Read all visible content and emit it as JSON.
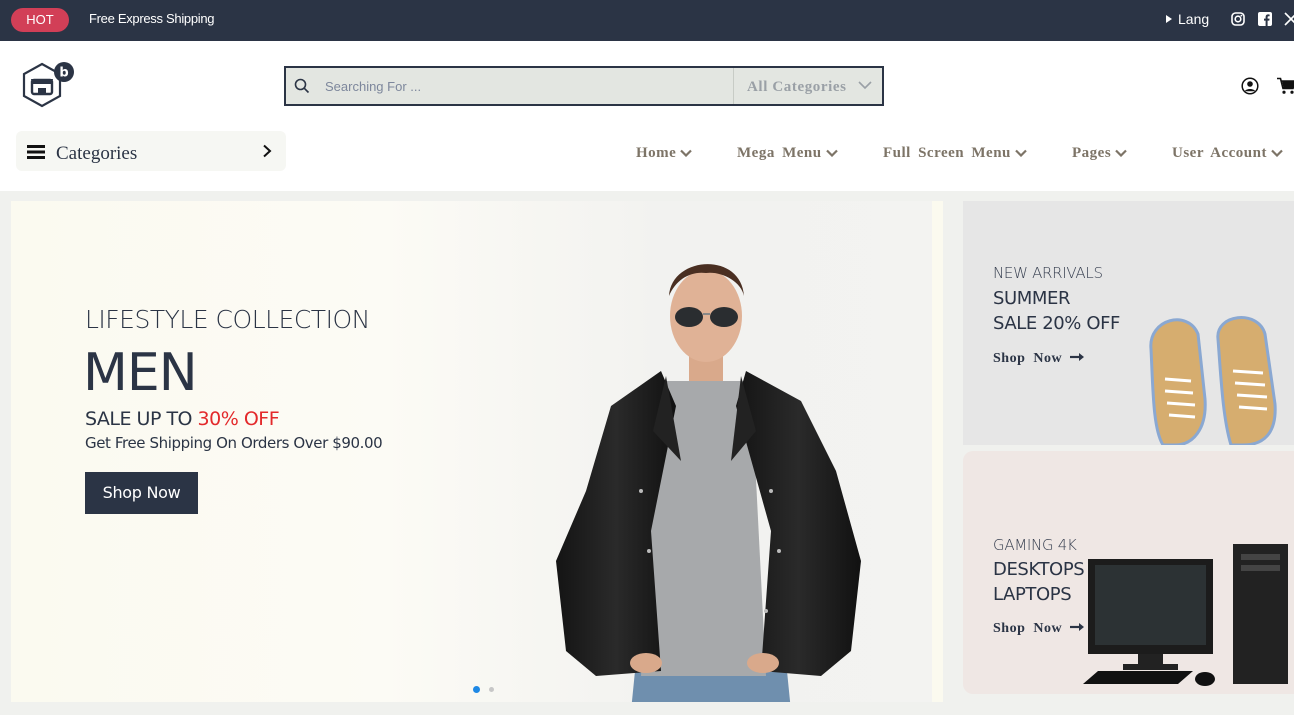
{
  "topbar": {
    "badge": "HOT",
    "promo": "Free Express Shipping",
    "lang": "Lang",
    "social": [
      "instagram-icon",
      "facebook-icon",
      "x-icon"
    ]
  },
  "header": {
    "search_placeholder": "Searching For ...",
    "category_select": "All  Categories"
  },
  "nav": {
    "categories_label": "Categories",
    "items": [
      {
        "label": "Home"
      },
      {
        "label": "Mega  Menu"
      },
      {
        "label": "Full  Screen  Menu"
      },
      {
        "label": "Pages"
      },
      {
        "label": "User  Account"
      }
    ]
  },
  "hero": {
    "subtitle": "LIFESTYLE COLLECTION",
    "title": "MEN",
    "sale_prefix": "SALE UP TO ",
    "sale_highlight": "30% OFF",
    "shipping": "Get Free Shipping On Orders Over $90.00",
    "button": "Shop Now",
    "slides": 2,
    "active_slide": 1
  },
  "promo_cards": [
    {
      "eyebrow": "NEW ARRIVALS",
      "line1": "SUMMER",
      "line2": "SALE 20% OFF",
      "link": "Shop  Now"
    },
    {
      "eyebrow": "GAMING 4K",
      "line1": "DESKTOPS &",
      "line2": "LAPTOPS",
      "link": "Shop  Now"
    }
  ],
  "colors": {
    "dark": "#2b3445",
    "hot": "#d23f57",
    "sale_red": "#e3292b",
    "nav_text": "#7d7467",
    "dot_active": "#1e88e5"
  }
}
